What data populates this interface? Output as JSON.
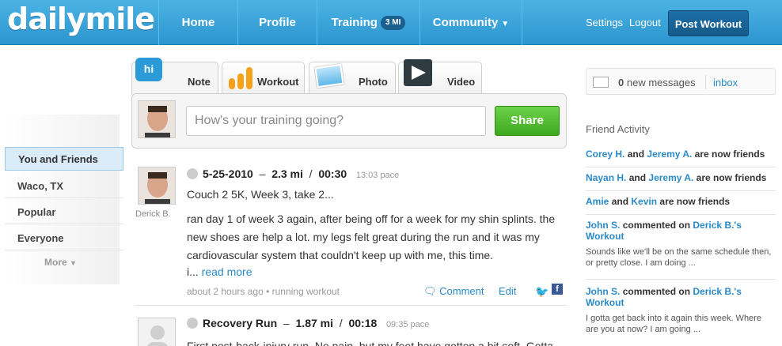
{
  "header": {
    "logo": "dailymile",
    "nav": {
      "home": "Home",
      "profile": "Profile",
      "training": "Training",
      "training_badge": "3 MI",
      "community": "Community"
    },
    "settings": "Settings",
    "logout": "Logout",
    "post_workout": "Post Workout"
  },
  "left_nav": {
    "items": [
      "You and Friends",
      "Waco, TX",
      "Popular",
      "Everyone"
    ],
    "more": "More"
  },
  "composer": {
    "tabs": {
      "note": "Note",
      "workout": "Workout",
      "photo": "Photo",
      "video": "Video"
    },
    "hi_icon_text": "hi",
    "placeholder": "How's your training going?",
    "share": "Share"
  },
  "feed": {
    "entries": [
      {
        "user": "Derick B.",
        "date": "5-25-2010",
        "distance": "2.3 mi",
        "time": "00:30",
        "pace": "13:03 pace",
        "title": "Couch 2 5K, Week 3, take 2...",
        "body": "ran day 1 of week 3 again, after being off for a week for my shin splints. the new shoes are help a lot. my legs felt great during the run and it was my cardiovascular system that couldn't keep up with me, this time.",
        "ellipsis": "i...",
        "read_more": "read more",
        "footer": "about 2 hours ago • running workout",
        "comment": "Comment",
        "edit": "Edit"
      },
      {
        "title": "Recovery Run",
        "distance": "1.87 mi",
        "time": "00:18",
        "pace": "09:35 pace",
        "body": "First post-back-injury run. No pain, but my feet have gotten a bit soft. Gotta"
      }
    ]
  },
  "sidebar": {
    "messages_count": "0",
    "messages_label": "new messages",
    "inbox": "inbox",
    "friend_activity_title": "Friend Activity",
    "activity": [
      {
        "a": "Corey H.",
        "joiner": "and",
        "b": "Jeremy A.",
        "text": "are now friends"
      },
      {
        "a": "Nayan H.",
        "joiner": "and",
        "b": "Jeremy A.",
        "text": "are now friends"
      },
      {
        "a": "Amie",
        "joiner": "and",
        "b": "Kevin",
        "text": "are now friends"
      },
      {
        "a": "John S.",
        "joiner": "commented on",
        "b": "Derick B.'s",
        "b2": "Workout",
        "quote": "Sounds like we'll be on the same schedule then, or pretty close. I am doing ..."
      },
      {
        "a": "John S.",
        "joiner": "commented on",
        "b": "Derick B.'s",
        "b2": "Workout",
        "quote": "I gotta get back into it again this week. Where are you at now? I am going ..."
      }
    ]
  }
}
